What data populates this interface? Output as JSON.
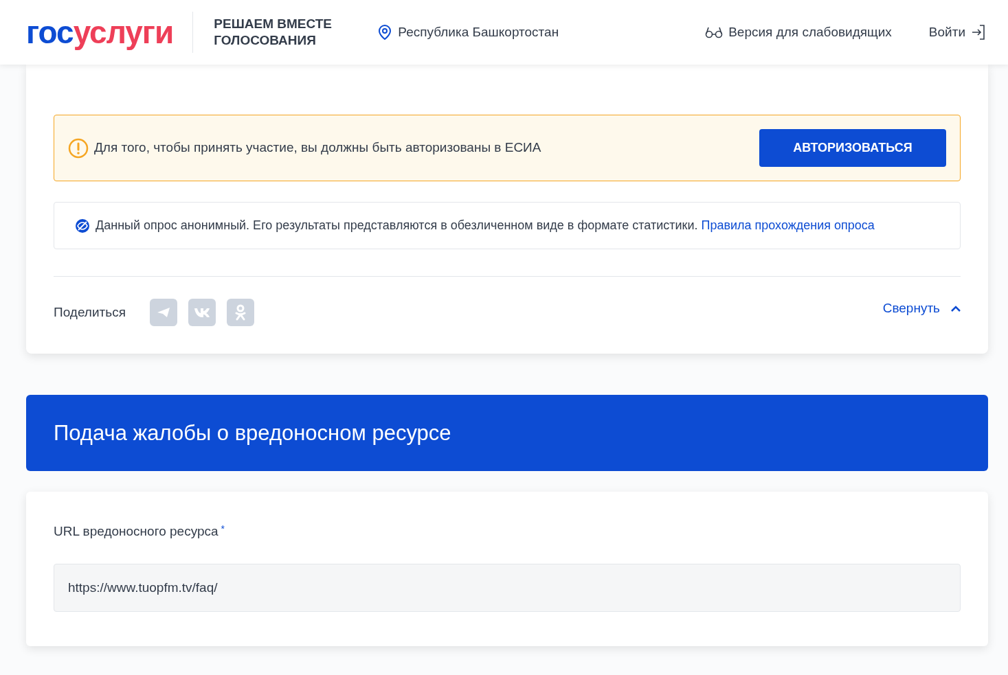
{
  "header": {
    "logo": [
      {
        "text": "гос",
        "color": "#0d4cd3"
      },
      {
        "text": "услуги",
        "color": "#ee3f58"
      }
    ],
    "project_title": "РЕШАЕМ ВМЕСТЕ ГОЛОСОВАНИЯ",
    "region": "Республика Башкортостан",
    "accessibility": "Версия для слабовидящих",
    "login": "Войти"
  },
  "poll_card": {
    "auth_alert": {
      "text": "Для того, чтобы принять участие, вы должны быть авторизованы в ЕСИА",
      "button": "АВТОРИЗОВАТЬСЯ"
    },
    "anonymous_note": {
      "text": "Данный опрос анонимный. Его результаты представляются в обезличенном виде в формате статистики.",
      "link": "Правила прохождения опроса"
    },
    "share_label": "Поделиться",
    "collapse": "Свернуть"
  },
  "complaint": {
    "title": "Подача жалобы о вредоносном ресурсе",
    "fields": [
      {
        "label": "URL вредоносного ресурса",
        "required_mark": "*",
        "value": "https://www.tuopfm.tv/faq/"
      }
    ]
  }
}
